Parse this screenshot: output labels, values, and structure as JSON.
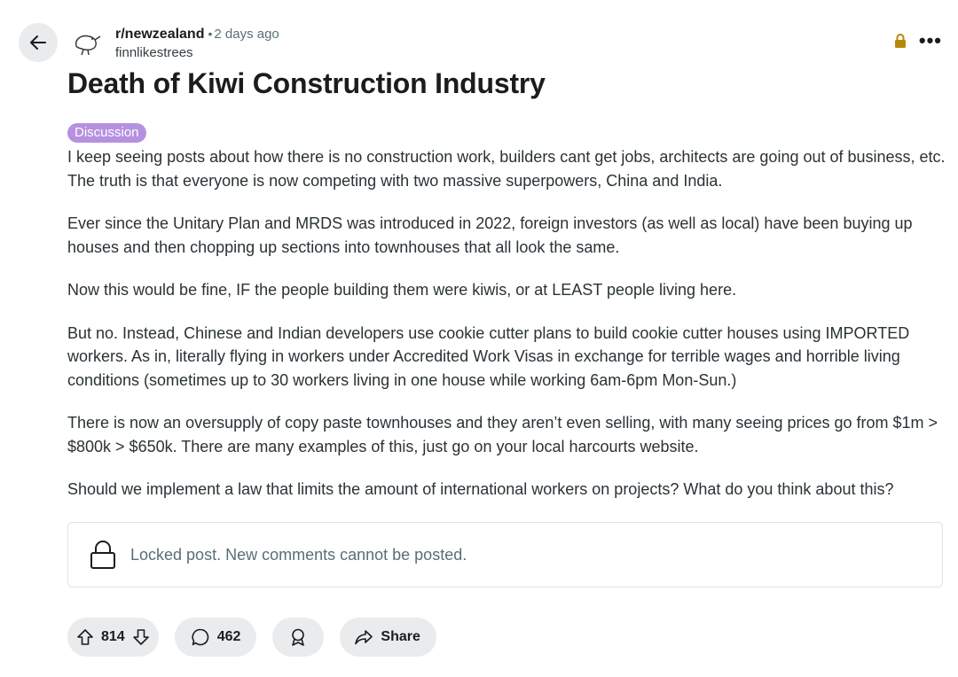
{
  "post": {
    "subreddit": "r/newzealand",
    "separator": "•",
    "time": "2 days ago",
    "author": "finnlikestrees",
    "title": "Death of Kiwi Construction Industry",
    "flair": "Discussion",
    "paragraphs": [
      "I keep seeing posts about how there is no construction work, builders cant get jobs, architects are going out of business, etc. The truth is that everyone is now competing with two massive superpowers, China and India.",
      "Ever since the Unitary Plan and MRDS was introduced in 2022, foreign investors (as well as local) have been buying up houses and then chopping up sections into townhouses that all look the same.",
      "Now this would be fine, IF the people building them were kiwis, or at LEAST people living here.",
      "But no. Instead, Chinese and Indian developers use cookie cutter plans to build cookie cutter houses using IMPORTED workers. As in, literally flying in workers under Accredited Work Visas in exchange for terrible wages and horrible living conditions (sometimes up to 30 workers living in one house while working 6am-6pm Mon-Sun.)",
      "There is now an oversupply of copy paste townhouses and they aren’t even selling, with many seeing prices go from $1m > $800k > $650k. There are many examples of this, just go on your local harcourts website.",
      "Should we implement a law that limits the amount of international workers on projects? What do you think about this?"
    ],
    "locked_notice": "Locked post. New comments cannot be posted.",
    "more_label": "•••"
  },
  "actions": {
    "votes": "814",
    "comments": "462",
    "share_label": "Share"
  },
  "icons": {
    "back": "arrow-left-icon",
    "subreddit_avatar": "kiwi-bird-icon",
    "lock": "lock-icon",
    "more": "more-horizontal-icon",
    "upvote": "upvote-arrow-icon",
    "downvote": "downvote-arrow-icon",
    "comment": "comment-bubble-icon",
    "award": "award-icon",
    "share": "share-arrow-icon"
  },
  "colors": {
    "flair_bg": "#b691e0",
    "lock_gold": "#b8860b",
    "pill_bg": "#e9ebed"
  }
}
